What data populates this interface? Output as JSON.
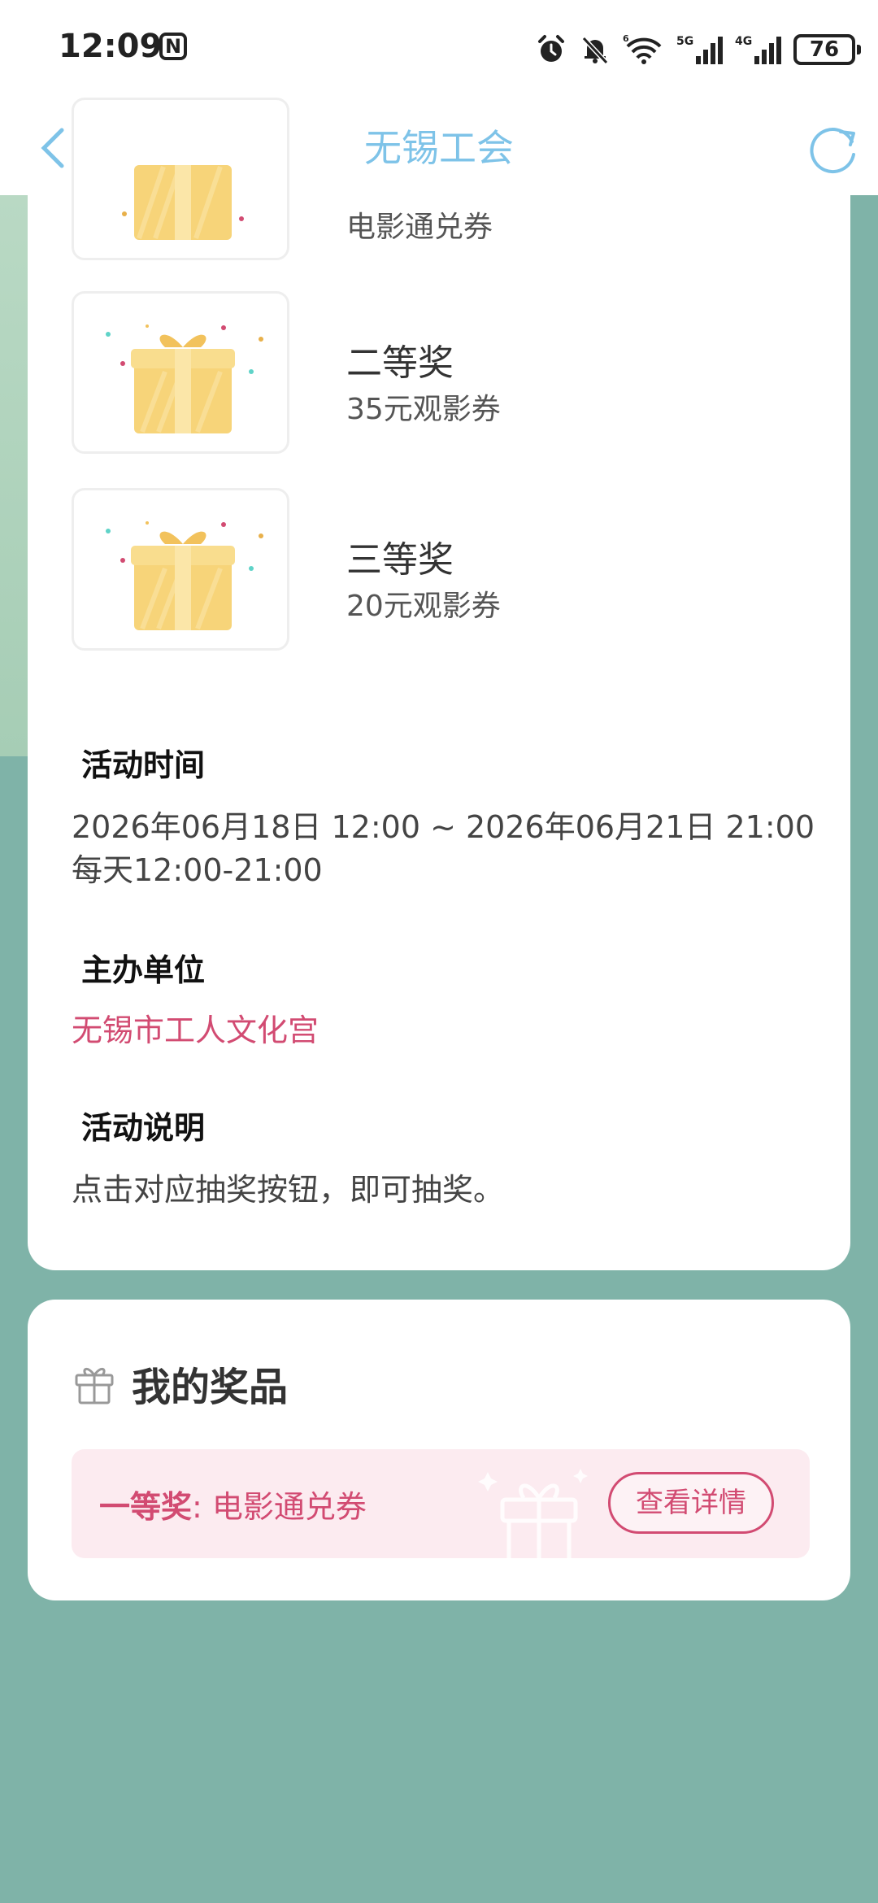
{
  "status_bar": {
    "time": "12:09",
    "nfc_label": "N",
    "battery": "76",
    "icons": [
      "alarm-icon",
      "mute-bell-icon",
      "wifi-icon",
      "5g-signal-icon",
      "4g-signal-icon",
      "battery-icon"
    ],
    "network_5g": "5G",
    "network_4g": "4G"
  },
  "nav": {
    "title": "无锡工会",
    "title_color": "#7ec3e8"
  },
  "prizes": [
    {
      "name": "",
      "desc": "电影通兑券"
    },
    {
      "name": "二等奖",
      "desc": "35元观影券"
    },
    {
      "name": "三等奖",
      "desc": "20元观影券"
    }
  ],
  "activity": {
    "time_title": "活动时间",
    "time_range": "2026年06月18日 12:00 ~ 2026年06月21日 21:00",
    "daily_time": "每天12:00-21:00",
    "organizer_title": "主办单位",
    "organizer": "无锡市工人文化宫",
    "desc_title": "活动说明",
    "desc": "点击对应抽奖按钮，即可抽奖。"
  },
  "my_prizes": {
    "title": "我的奖品",
    "item_level": "一等奖",
    "item_sep": ": ",
    "item_name": "电影通兑券",
    "detail_button": "查看详情"
  },
  "colors": {
    "background": "#7fb3a8",
    "accent_pink": "#d24b72",
    "highlight_pink": "#fbe3ea",
    "nav_blue": "#7ec3e8"
  }
}
